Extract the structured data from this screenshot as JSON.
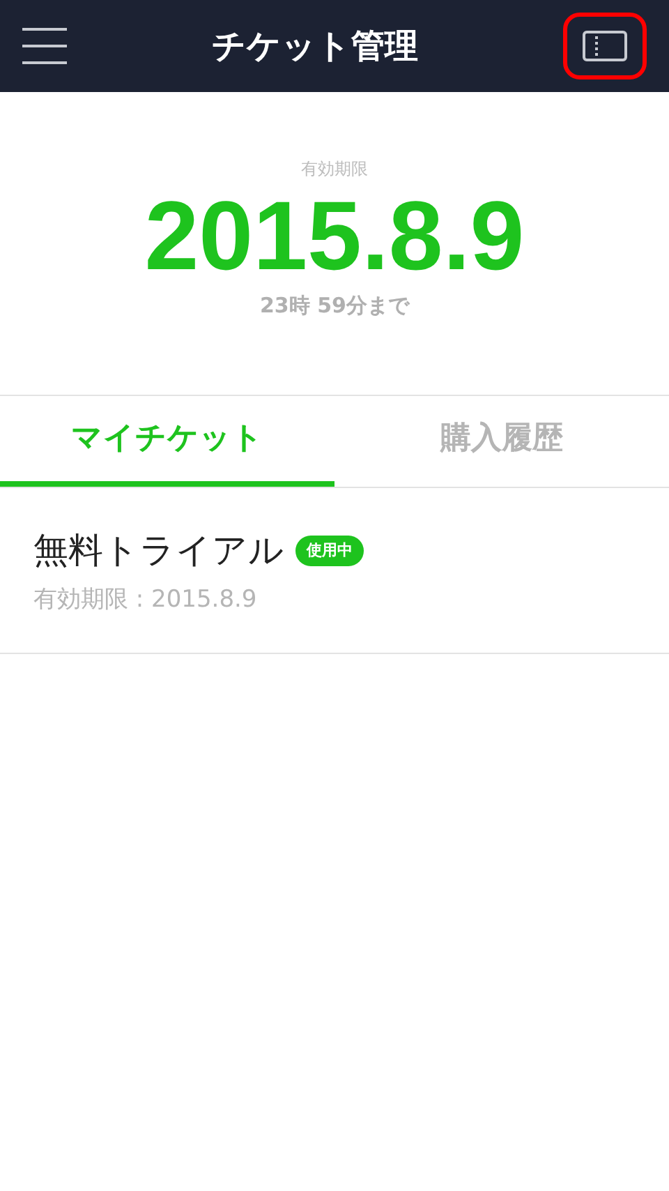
{
  "header": {
    "title": "チケット管理",
    "highlighted_button": true
  },
  "expiry": {
    "label": "有効期限",
    "date": "2015.8.9",
    "remaining": "23時 59分まで"
  },
  "tabs": [
    {
      "label": "マイチケット",
      "selected": true
    },
    {
      "label": "購入履歴",
      "selected": false
    }
  ],
  "tickets": [
    {
      "name": "無料トライアル",
      "badge": "使用中",
      "detail": "有効期限 : 2015.8.9"
    }
  ]
}
